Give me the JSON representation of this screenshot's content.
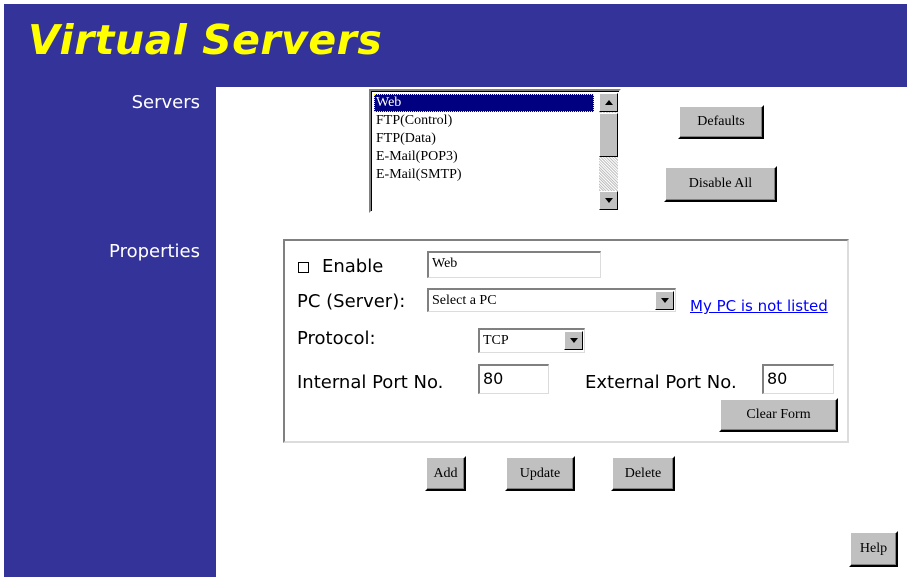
{
  "page": {
    "title": "Virtual Servers"
  },
  "sidebar": {
    "servers_label": "Servers",
    "properties_label": "Properties"
  },
  "servers": {
    "items": [
      "Web",
      "FTP(Control)",
      "FTP(Data)",
      "E-Mail(POP3)",
      "E-Mail(SMTP)"
    ],
    "selected": "Web",
    "defaults_label": "Defaults",
    "disable_all_label": "Disable All"
  },
  "properties": {
    "enable_label": "Enable",
    "enable_checked": false,
    "name_value": "Web",
    "pc_label": "PC (Server):",
    "pc_selected": "Select a PC",
    "not_listed_link": "My PC is not listed",
    "protocol_label": "Protocol:",
    "protocol_selected": "TCP",
    "internal_port_label": "Internal Port No.",
    "internal_port_value": "80",
    "external_port_label": "External Port No.",
    "external_port_value": "80",
    "clear_form_label": "Clear Form"
  },
  "actions": {
    "add_label": "Add",
    "update_label": "Update",
    "delete_label": "Delete",
    "help_label": "Help"
  },
  "colors": {
    "navy": "#333399",
    "title": "#ffff00",
    "selection": "#000080",
    "link": "#0000ff"
  }
}
